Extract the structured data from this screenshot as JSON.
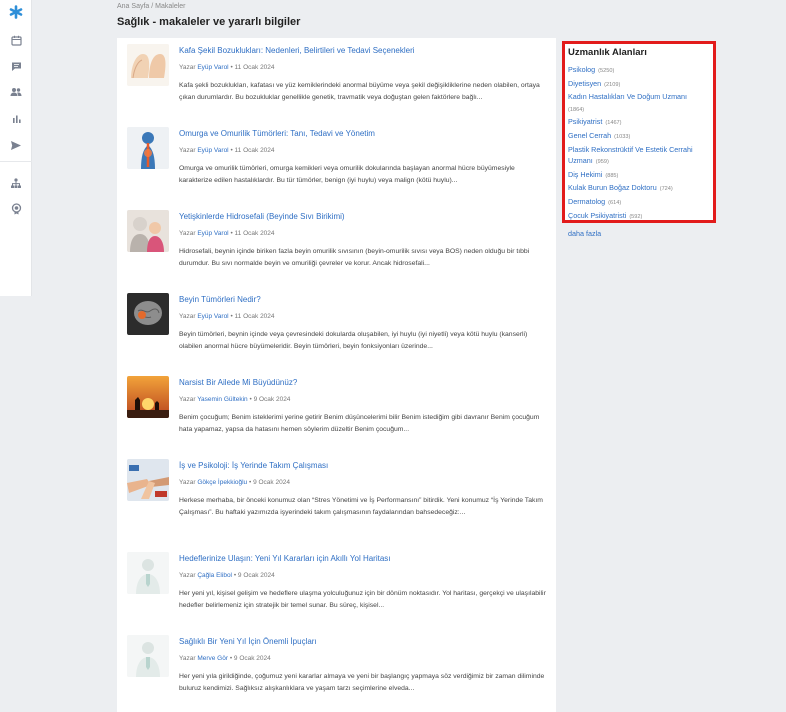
{
  "breadcrumb": {
    "home": "Ana Sayfa",
    "separator": "/",
    "current": "Makaleler"
  },
  "page_title": "Sağlık - makaleler ve yararlı bilgiler",
  "sidebar_nav": [
    {
      "icon": "logo-icon"
    },
    {
      "icon": "calendar-icon"
    },
    {
      "icon": "messages-icon"
    },
    {
      "icon": "users-icon"
    },
    {
      "icon": "stats-icon"
    },
    {
      "icon": "send-icon"
    },
    {
      "icon": "org-chart-icon"
    },
    {
      "icon": "badge-icon"
    }
  ],
  "articles": [
    {
      "title": "Kafa Şekil Bozuklukları: Nedenleri, Belirtileri ve Tedavi Seçenekleri",
      "by": "Yazar",
      "author": "Eyüp Varol",
      "date": "• 11 Ocak 2024",
      "excerpt": "Kafa şekli bozuklukları, kafatası ve yüz kemiklerindeki anormal büyüme veya şekil değişikliklerine neden olabilen, ortaya çıkan durumlardır. Bu bozukluklar genellikle genetik, travmatik veya doğuştan gelen faktörlere bağlı...",
      "thumb": "skull-shape"
    },
    {
      "title": "Omurga ve Omurilik Tümörleri: Tanı, Tedavi ve Yönetim",
      "by": "Yazar",
      "author": "Eyüp Varol",
      "date": "• 11 Ocak 2024",
      "excerpt": "Omurga ve omurilik tümörleri, omurga kemikleri veya omurilik dokularında başlayan anormal hücre büyümesiyle karakterize edilen hastalıklardır. Bu tür tümörler, benign (iyi huylu) veya malign (kötü huylu)...",
      "thumb": "spine"
    },
    {
      "title": "Yetişkinlerde Hidrosefali (Beyinde Sıvı Birikimi)",
      "by": "Yazar",
      "author": "Eyüp Varol",
      "date": "• 11 Ocak 2024",
      "excerpt": "Hidrosefali, beynin içinde biriken fazla beyin omurilik sıvısının (beyin-omurilik sıvısı veya BOS) neden olduğu bir tıbbi durumdur. Bu sıvı normalde beyin ve omuriliği çevreler ve korur. Ancak hidrosefali...",
      "thumb": "people"
    },
    {
      "title": "Beyin Tümörleri Nedir?",
      "by": "Yazar",
      "author": "Eyüp Varol",
      "date": "• 11 Ocak 2024",
      "excerpt": "Beyin tümörleri, beynin içinde veya çevresindeki dokularda oluşabilen, iyi huylu (iyi niyetli) veya kötü huylu (kanserli) olabilen anormal hücre büyümeleridir. Beyin tümörleri, beyin fonksiyonları üzerinde...",
      "thumb": "brain"
    },
    {
      "title": "Narsist Bir Ailede Mi Büyüdünüz?",
      "by": "Yazar",
      "author": "Yasemin Gültekin",
      "date": "• 9 Ocak 2024",
      "excerpt": "Benim çocuğum; Benim isteklerimi yerine getirir Benim düşüncelerimi bilir Benim istediğim gibi davranır Benim çocuğum hata yapamaz, yapsa da hatasını hemen söylerim düzeltir Benim çocuğum...",
      "thumb": "sunset"
    },
    {
      "title": "İş ve Psikoloji: İş Yerinde Takım Çalışması",
      "by": "Yazar",
      "author": "Gökçe İpekkioğlu",
      "date": "• 9 Ocak 2024",
      "excerpt": "Herkese merhaba, bir önceki konumuz olan “Stres Yönetimi ve İş Performansını” bitirdik. Yeni konumuz “İş Yerinde Takım Çalışması”. Bu haftaki yazımızda işyerindeki takım çalışmasının faydalarından bahsedeceğiz:...",
      "thumb": "hands"
    },
    {
      "title": "Hedeflerinize Ulaşın: Yeni Yıl Kararları için Akıllı Yol Haritası",
      "by": "Yazar",
      "author": "Çağla Elibol",
      "date": "• 9 Ocak 2024",
      "excerpt": "Her yeni yıl, kişisel gelişim ve hedeflere ulaşma yolculuğunuz için bir dönüm noktasıdır. Yol haritası, gerçekçi ve ulaşılabilir hedefler belirlemeniz için stratejik bir temel sunar. Bu süreç, kişisel...",
      "thumb": "placeholder"
    },
    {
      "title": "Sağlıklı Bir Yeni Yıl İçin Önemli İpuçları",
      "by": "Yazar",
      "author": "Merve Gör",
      "date": "• 9 Ocak 2024",
      "excerpt": "Her yeni yıla girildiğinde, çoğumuz yeni kararlar almaya ve yeni bir başlangıç yapmaya söz verdiğimiz bir zaman diliminde buluruz kendimizi. Sağlıksız alışkanlıklara ve yaşam tarzı seçimlerine elveda...",
      "thumb": "placeholder"
    }
  ],
  "specialties": {
    "title": "Uzmanlık Alanları",
    "items": [
      {
        "label": "Psikolog",
        "count": "(5250)"
      },
      {
        "label": "Diyetisyen",
        "count": "(2109)"
      },
      {
        "label": "Kadın Hastalıkları Ve Doğum Uzmanı",
        "count": "(1864)"
      },
      {
        "label": "Psikiyatrist",
        "count": "(1467)"
      },
      {
        "label": "Genel Cerrah",
        "count": "(1033)"
      },
      {
        "label": "Plastik Rekonstrüktif Ve Estetik Cerrahi Uzmanı",
        "count": "(959)"
      },
      {
        "label": "Diş Hekimi",
        "count": "(885)"
      },
      {
        "label": "Kulak Burun Boğaz Doktoru",
        "count": "(724)"
      },
      {
        "label": "Dermatolog",
        "count": "(614)"
      },
      {
        "label": "Çocuk Psikiyatristi",
        "count": "(592)"
      }
    ],
    "more": "daha fazla"
  },
  "colors": {
    "link": "#2f6fc4",
    "highlight_border": "#e21b1b",
    "nav_icon": "#7a8190",
    "logo": "#2f8fd8"
  }
}
